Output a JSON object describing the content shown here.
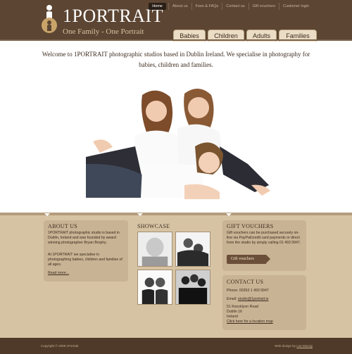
{
  "brand": {
    "name": "1PORTRAIT",
    "tagline": "One Family - One Portrait",
    "accent_color": "#5c4532",
    "tab_color": "#ebddc5",
    "band_color": "#d6c3a4"
  },
  "topnav": [
    {
      "label": "Home",
      "active": true
    },
    {
      "label": "About us",
      "active": false
    },
    {
      "label": "Fees & FAQs",
      "active": false
    },
    {
      "label": "Contact us",
      "active": false
    },
    {
      "label": "Gift vouchers",
      "active": false
    },
    {
      "label": "Customer login",
      "active": false
    }
  ],
  "tabs": [
    "Babies",
    "Children",
    "Adults",
    "Families"
  ],
  "intro": {
    "line1": "Welcome to 1PORTRAIT photographic studios based in Dublin Ireland. We specialise in photography for",
    "line2": "babies, children and families."
  },
  "about": {
    "title": "ABOUT US",
    "para1": "1PORTRAIT photographic studio is based in Dublin, Ireland and was founded by award winning photographer Bryan Brophy.",
    "para2": "At 1PORTRAIT we specialise in photographing babies, children and families of all ages.",
    "read_more": "Read more..."
  },
  "showcase": {
    "title": "SHOWCASE",
    "thumbs": [
      "baby portrait",
      "family portrait",
      "couple portrait",
      "group portrait"
    ]
  },
  "gift": {
    "title": "GIFT VOUCHERS",
    "text": "Gift vouchers can be purchased securely on-line via PayPal/credit card payments or direct from the studio by simply calling 01 493 9947.",
    "button": "Gift vouchers"
  },
  "contact": {
    "title": "CONTACT US",
    "phone": "Phone: 00353 1 493 9947",
    "email_label": "Email:",
    "email": "studio@1portrait.ie",
    "address1": "51 Knocklyon Road",
    "address2": "Dublin 16",
    "address3": "Ireland",
    "map_link": "Click here for a location map"
  },
  "footer": {
    "copyright": "Copyright © 2008 1Portrait",
    "credit_prefix": "Web design by",
    "credit_name": "Lee Murray"
  }
}
